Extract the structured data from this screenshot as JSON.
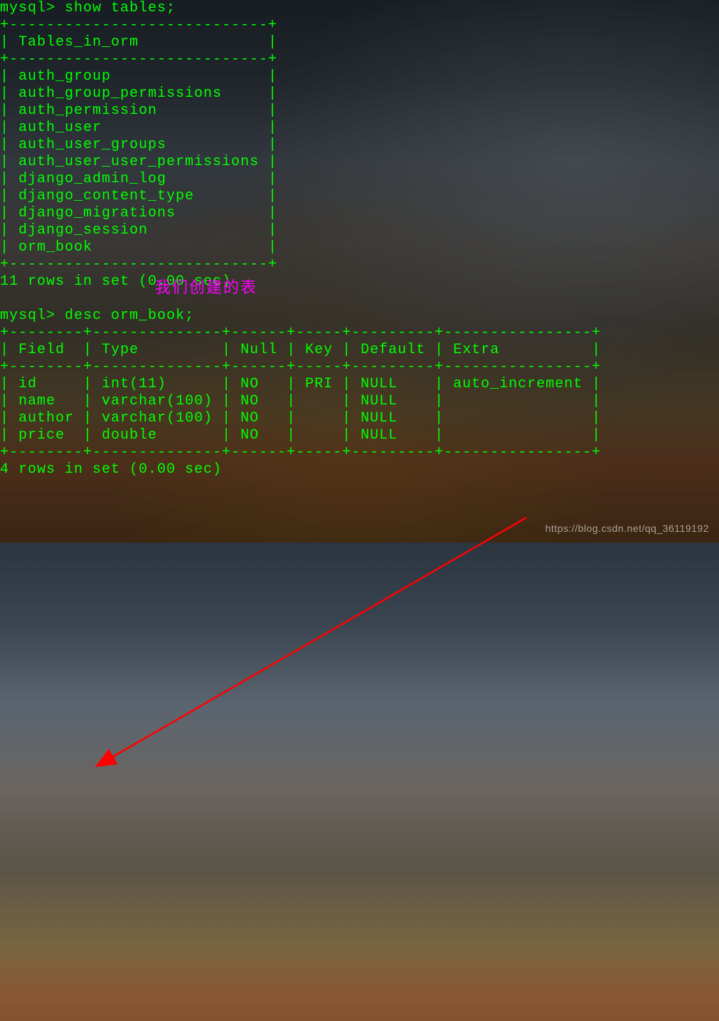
{
  "prompt_label": "mysql>",
  "commands": {
    "show_tables": "show tables;",
    "desc_book": "desc orm_book;"
  },
  "tables_header": "Tables_in_orm",
  "tables_list": [
    "auth_group",
    "auth_group_permissions",
    "auth_permission",
    "auth_user",
    "auth_user_groups",
    "auth_user_user_permissions",
    "django_admin_log",
    "django_content_type",
    "django_migrations",
    "django_session",
    "orm_book"
  ],
  "tables_footer": "11 rows in set (0.00 sec)",
  "desc_headers": {
    "field": "Field",
    "type": "Type",
    "null": "Null",
    "key": "Key",
    "default": "Default",
    "extra": "Extra"
  },
  "desc_rows": [
    {
      "field": "id",
      "type": "int(11)",
      "null": "NO",
      "key": "PRI",
      "default": "NULL",
      "extra": "auto_increment"
    },
    {
      "field": "name",
      "type": "varchar(100)",
      "null": "NO",
      "key": "",
      "default": "NULL",
      "extra": ""
    },
    {
      "field": "author",
      "type": "varchar(100)",
      "null": "NO",
      "key": "",
      "default": "NULL",
      "extra": ""
    },
    {
      "field": "price",
      "type": "double",
      "null": "NO",
      "key": "",
      "default": "NULL",
      "extra": ""
    }
  ],
  "desc_footer": "4 rows in set (0.00 sec)",
  "annotation_text": "我们创建的表",
  "watermark": "https://blog.csdn.net/qq_36119192",
  "borders": {
    "t1_top": "+----------------------------+",
    "t1_header": "| Tables_in_orm              |",
    "t1_sep": "+----------------------------+",
    "t1_bot": "+----------------------------+",
    "t2_top": "+--------+--------------+------+-----+---------+----------------+",
    "t2_sep": "+--------+--------------+------+-----+---------+----------------+",
    "t2_bot": "+--------+--------------+------+-----+---------+----------------+"
  }
}
